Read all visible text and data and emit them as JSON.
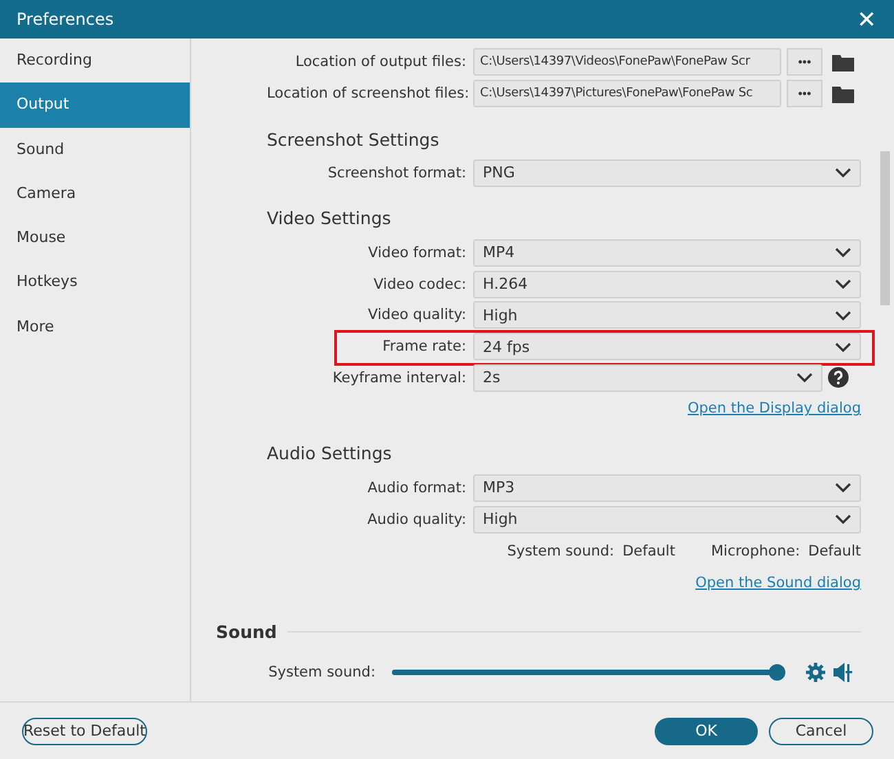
{
  "window": {
    "title": "Preferences",
    "close": "✕"
  },
  "sidebar": {
    "items": [
      {
        "label": "Recording",
        "selected": false
      },
      {
        "label": "Output",
        "selected": true
      },
      {
        "label": "Sound",
        "selected": false
      },
      {
        "label": "Camera",
        "selected": false
      },
      {
        "label": "Mouse",
        "selected": false
      },
      {
        "label": "Hotkeys",
        "selected": false
      },
      {
        "label": "More",
        "selected": false
      }
    ]
  },
  "locations": [
    {
      "label": "Location of output files:",
      "value": "C:\\Users\\14397\\Videos\\FonePaw\\FonePaw Scr",
      "browse": "•••"
    },
    {
      "label": "Location of screenshot files:",
      "value": "C:\\Users\\14397\\Pictures\\FonePaw\\FonePaw Sc",
      "browse": "•••"
    }
  ],
  "sections": [
    {
      "title": "Screenshot Settings",
      "items": [
        {
          "kind": "select",
          "label": "Screenshot format:",
          "value": "PNG",
          "highlighted": false,
          "help": false
        }
      ]
    },
    {
      "title": "Video Settings",
      "items": [
        {
          "kind": "select",
          "label": "Video format:",
          "value": "MP4",
          "highlighted": false,
          "help": false
        },
        {
          "kind": "select",
          "label": "Video codec:",
          "value": "H.264",
          "highlighted": false,
          "help": false
        },
        {
          "kind": "select",
          "label": "Video quality:",
          "value": "High",
          "highlighted": false,
          "help": false
        },
        {
          "kind": "select",
          "label": "Frame rate:",
          "value": "24 fps",
          "highlighted": true,
          "help": false
        },
        {
          "kind": "select",
          "label": "Keyframe interval:",
          "value": "2s",
          "highlighted": false,
          "help": true
        },
        {
          "kind": "link",
          "text": "Open the Display dialog"
        }
      ]
    },
    {
      "title": "Audio Settings",
      "items": [
        {
          "kind": "select",
          "label": "Audio format:",
          "value": "MP3",
          "highlighted": false,
          "help": false
        },
        {
          "kind": "select",
          "label": "Audio quality:",
          "value": "High",
          "highlighted": false,
          "help": false
        },
        {
          "kind": "info",
          "pairs": [
            {
              "label": "System sound:",
              "value": "Default"
            },
            {
              "label": "Microphone:",
              "value": "Default"
            }
          ]
        },
        {
          "kind": "link",
          "text": "Open the Sound dialog"
        }
      ]
    }
  ],
  "sound": {
    "title": "Sound",
    "rows": [
      {
        "label": "System sound:",
        "level": 1
      }
    ]
  },
  "footer": {
    "reset": "Reset to Default",
    "ok": "OK",
    "cancel": "Cancel"
  }
}
